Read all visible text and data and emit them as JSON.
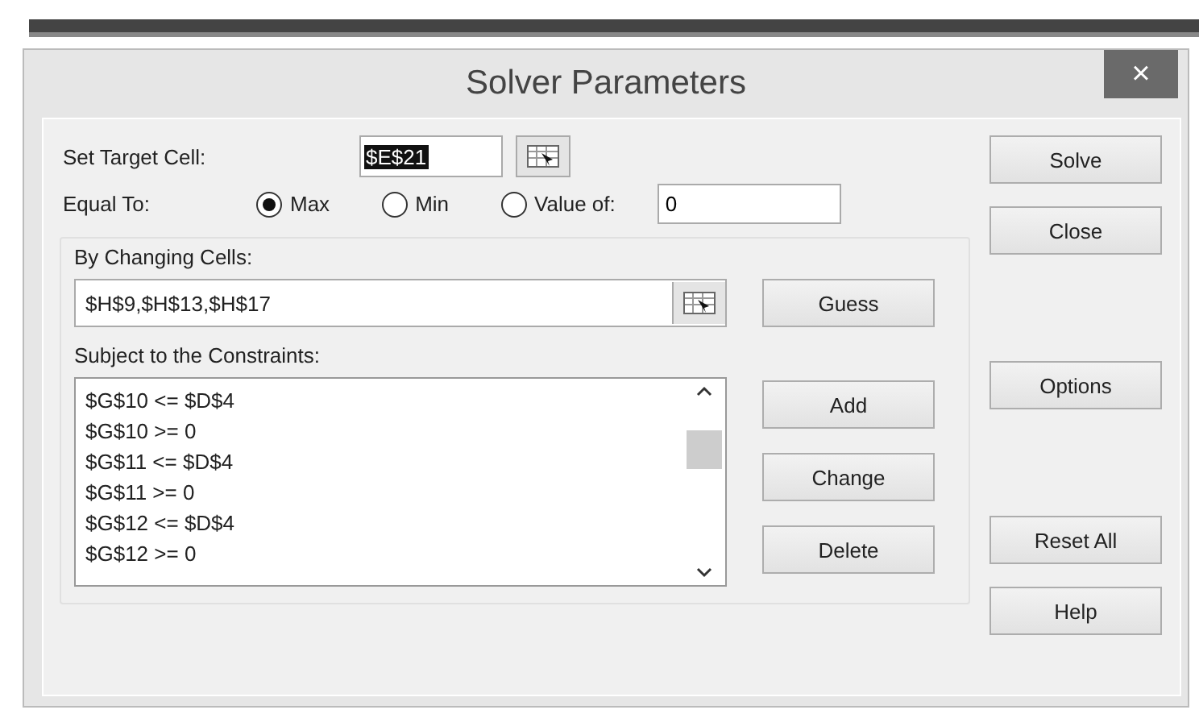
{
  "window": {
    "title": "Solver Parameters",
    "close": "×"
  },
  "target": {
    "label": "Set Target Cell:",
    "value": "$E$21",
    "selected": true
  },
  "equal_to": {
    "label": "Equal To:",
    "options": [
      {
        "label": "Max",
        "selected": true
      },
      {
        "label": "Min",
        "selected": false
      },
      {
        "label": "Value of:",
        "selected": false
      }
    ],
    "value": "0"
  },
  "changing_cells": {
    "label": "By Changing Cells:",
    "value": "$H$9,$H$13,$H$17",
    "button": "Guess"
  },
  "constraints": {
    "label": "Subject to the Constraints:",
    "items": [
      "$G$10 <= $D$4",
      "$G$10 >= 0",
      "$G$11 <= $D$4",
      "$G$11 >= 0",
      "$G$12 <= $D$4",
      "$G$12 >= 0"
    ],
    "buttons": [
      "Add",
      "Change",
      "Delete"
    ]
  },
  "side_buttons": {
    "top": [
      "Solve",
      "Close"
    ],
    "middle": [
      "Options"
    ],
    "bottom": [
      "Reset All",
      "Help"
    ]
  }
}
